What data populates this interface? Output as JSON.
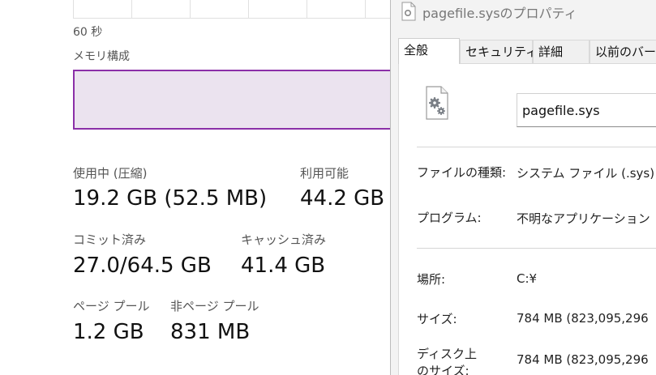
{
  "task_manager": {
    "graph_time_label": "60 秒",
    "memory_composition_label": "メモリ構成",
    "stats": {
      "in_use_label": "使用中 (圧縮)",
      "in_use_value": "19.2 GB (52.5 MB)",
      "available_label": "利用可能",
      "available_value": "44.2 GB",
      "committed_label": "コミット済み",
      "committed_value": "27.0/64.5 GB",
      "cached_label": "キャッシュ済み",
      "cached_value": "41.4 GB",
      "paged_pool_label": "ページ プール",
      "paged_pool_value": "1.2 GB",
      "nonpaged_pool_label": "非ページ プール",
      "nonpaged_pool_value": "831 MB"
    },
    "colors": {
      "composition_border": "#8b2fa8",
      "composition_fill": "#ebe3ef"
    }
  },
  "properties_dialog": {
    "title": "pagefile.sysのプロパティ",
    "tabs": [
      {
        "label": "全般",
        "active": true
      },
      {
        "label": "セキュリティ",
        "active": false
      },
      {
        "label": "詳細",
        "active": false
      },
      {
        "label": "以前のバー",
        "active": false
      }
    ],
    "file_name": "pagefile.sys",
    "file_icon": "system-file-gear-icon",
    "fields": {
      "type_label": "ファイルの種類:",
      "type_value": "システム ファイル (.sys)",
      "program_label": "プログラム:",
      "program_value": "不明なアプリケーション",
      "location_label": "場所:",
      "location_value": "C:¥",
      "size_label": "サイズ:",
      "size_value": "784 MB (823,095,296",
      "size_on_disk_label_line1": "ディスク上",
      "size_on_disk_label_line2": "のサイズ:",
      "size_on_disk_value": "784 MB (823,095,296"
    }
  }
}
